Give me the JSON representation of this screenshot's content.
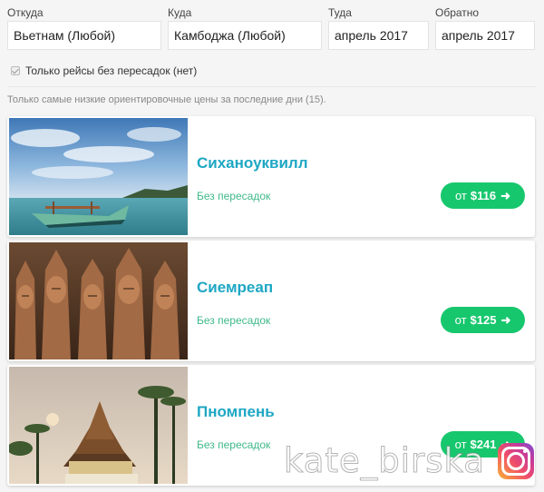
{
  "search": {
    "from": {
      "label": "Откуда",
      "value": "Вьетнам (Любой)"
    },
    "to": {
      "label": "Куда",
      "value": "Камбоджа (Любой)"
    },
    "depart": {
      "label": "Туда",
      "value": "апрель 2017"
    },
    "return": {
      "label": "Обратно",
      "value": "апрель 2017"
    },
    "direct_only": {
      "label": "Только рейсы без пересадок (нет)",
      "checked": true
    }
  },
  "note": "Только самые низкие ориентировочные цены за последние дни (15).",
  "results": [
    {
      "city": "Сиханоуквилл",
      "stops": "Без пересадок",
      "price_prefix": "от",
      "price": "$116",
      "image": "boat-beach-photo"
    },
    {
      "city": "Сиемреап",
      "stops": "Без пересадок",
      "price_prefix": "от",
      "price": "$125",
      "image": "temple-statues-photo"
    },
    {
      "city": "Пномпень",
      "stops": "Без пересадок",
      "price_prefix": "от",
      "price": "$241",
      "image": "pagoda-palms-photo"
    }
  ],
  "watermark": "kate_birska",
  "colors": {
    "accent_text": "#1ea7c4",
    "button": "#17c76d",
    "stops_text": "#3fb98a"
  },
  "icons": {
    "button_arrow": "arrow-right-icon",
    "watermark_icon": "instagram-icon"
  }
}
